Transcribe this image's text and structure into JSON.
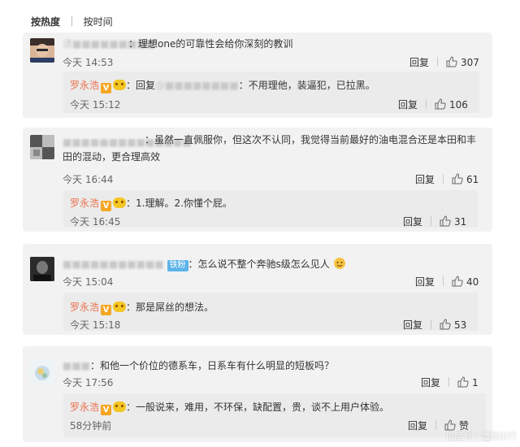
{
  "tabs": {
    "hot": "按热度",
    "time": "按时间"
  },
  "comments": [
    {
      "user": "请■■■■■■■■■",
      "text": "：理想one的可靠性会给你深刻的教训",
      "time": "今天 14:53",
      "reply_label": "回复",
      "likes": "307",
      "reply": {
        "user": "罗永浩",
        "prefix": "：回复",
        "mention": "@■■■■■■■■",
        "text": "：不用理他，装逼犯，已拉黑。",
        "time": "今天 15:12",
        "reply_label": "回复",
        "likes": "106"
      }
    },
    {
      "user": "■■■■■■■■■■■■■■",
      "text": "：虽然一直佩服你，但这次不认同，我觉得当前最好的油电混合还是本田和丰田的混动，更合理高效",
      "time": "今天 16:44",
      "reply_label": "回复",
      "likes": "61",
      "reply": {
        "user": "罗永浩",
        "text": "：1.理解。2.你懂个屁。",
        "time": "今天 16:45",
        "reply_label": "回复",
        "likes": "31"
      }
    },
    {
      "user": "■■■■■■■■■■■",
      "badge": "铁粉",
      "text": "：怎么说不整个奔驰s级怎么见人",
      "time": "今天 15:04",
      "reply_label": "回复",
      "likes": "40",
      "reply": {
        "user": "罗永浩",
        "text": "：那是屌丝的想法。",
        "time": "今天 15:18",
        "reply_label": "回复",
        "likes": "53"
      }
    },
    {
      "user": "■■■",
      "text": "：和他一个价位的德系车，日系车有什么明显的短板吗？",
      "time": "今天 17:56",
      "reply_label": "回复",
      "likes": "1",
      "reply": {
        "user": "罗永浩",
        "text": "：一般说来，难用，不环保，缺配置，贵，谈不上用户体验。",
        "time": "58分钟前",
        "reply_label": "回复",
        "likes": "赞"
      }
    }
  ],
  "watermark": "百度号 / 懂懂出行",
  "colors": {
    "card_bg": "#f2f2f2",
    "reply_bg": "#ebebeb",
    "reply_name": "#eb7350",
    "badge_blue": "#5bb3e8",
    "v_badge": "#f5a623"
  },
  "icons": {
    "like": "thumbs-up-icon",
    "verified": "v-verified-icon",
    "level": "level-face-icon",
    "emoji": "smile-emoji-icon"
  }
}
